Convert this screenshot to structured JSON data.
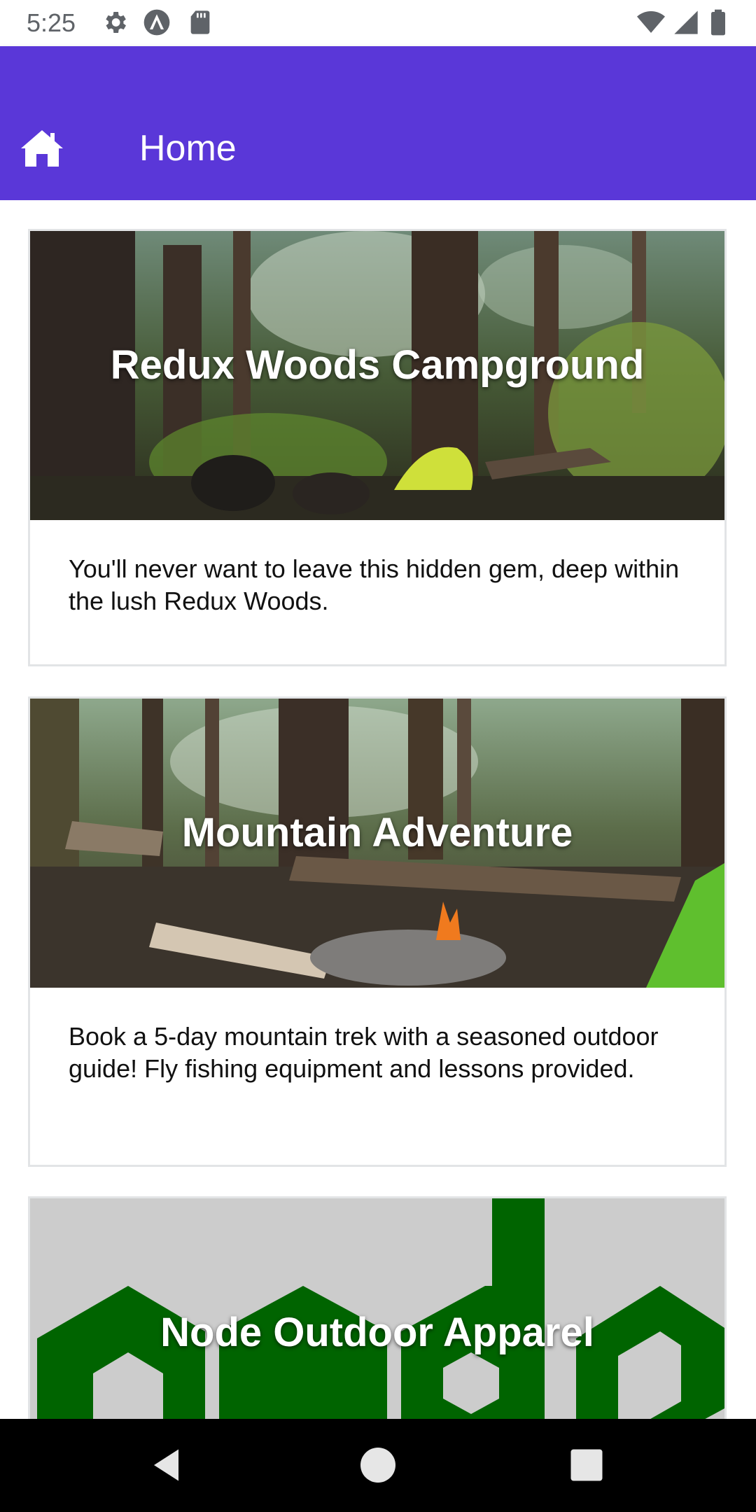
{
  "status_bar": {
    "time": "5:25",
    "left_icons": [
      "gear-icon",
      "a-badge-icon",
      "sd-card-icon"
    ],
    "right_icons": [
      "wifi-icon",
      "signal-icon",
      "battery-icon"
    ]
  },
  "app_bar": {
    "title": "Home",
    "icon": "home-icon",
    "color": "#5a37d8"
  },
  "cards": [
    {
      "title": "Redux Woods Campground",
      "description": "You'll never want to leave this hidden gem, deep within the lush Redux Woods."
    },
    {
      "title": "Mountain Adventure",
      "description": "Book a 5-day mountain trek with a seasoned outdoor guide! Fly fishing equipment and lessons provided."
    },
    {
      "title": "Node Outdoor Apparel",
      "description": ""
    }
  ],
  "nav_bar": {
    "buttons": [
      "back-icon",
      "home-circle-icon",
      "recents-icon"
    ]
  }
}
